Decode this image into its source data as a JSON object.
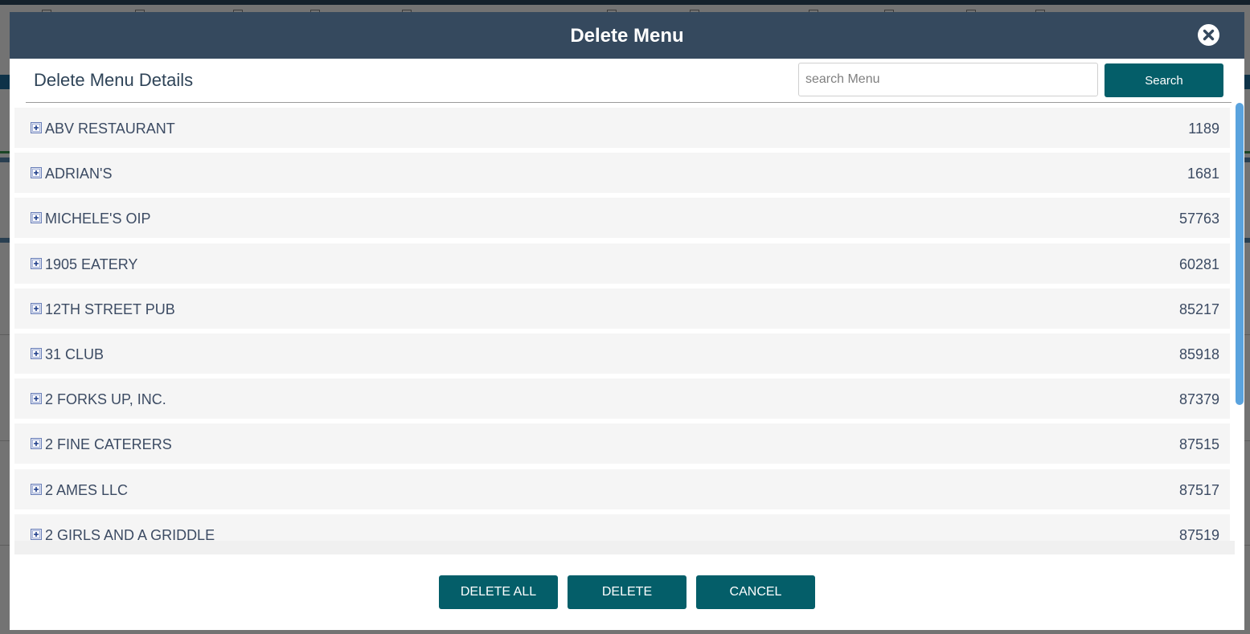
{
  "dialog": {
    "title": "Delete Menu",
    "close_icon": "close-circle-icon",
    "details_heading": "Delete Menu Details",
    "search": {
      "placeholder": "search Menu",
      "value": "",
      "button_label": "Search"
    },
    "expand_icon": "plus-square-icon",
    "menus": [
      {
        "name": "ABV RESTAURANT",
        "id": "1189"
      },
      {
        "name": "ADRIAN'S",
        "id": "1681"
      },
      {
        "name": "MICHELE'S OIP",
        "id": "57763"
      },
      {
        "name": "1905 EATERY",
        "id": "60281"
      },
      {
        "name": "12TH STREET PUB",
        "id": "85217"
      },
      {
        "name": "31 CLUB",
        "id": "85918"
      },
      {
        "name": "2 FORKS UP, INC.",
        "id": "87379"
      },
      {
        "name": "2 FINE CATERERS",
        "id": "87515"
      },
      {
        "name": "2 AMES LLC",
        "id": "87517"
      },
      {
        "name": "2 GIRLS AND A GRIDDLE",
        "id": "87519"
      }
    ],
    "buttons": {
      "delete_all": "DELETE ALL",
      "delete": "DELETE",
      "cancel": "CANCEL"
    }
  },
  "colors": {
    "header_bg": "#35495e",
    "button_bg": "#045e69",
    "row_bg": "#f5f5f5",
    "scrollbar": "#5aa3de",
    "text": "#3c4b63"
  }
}
